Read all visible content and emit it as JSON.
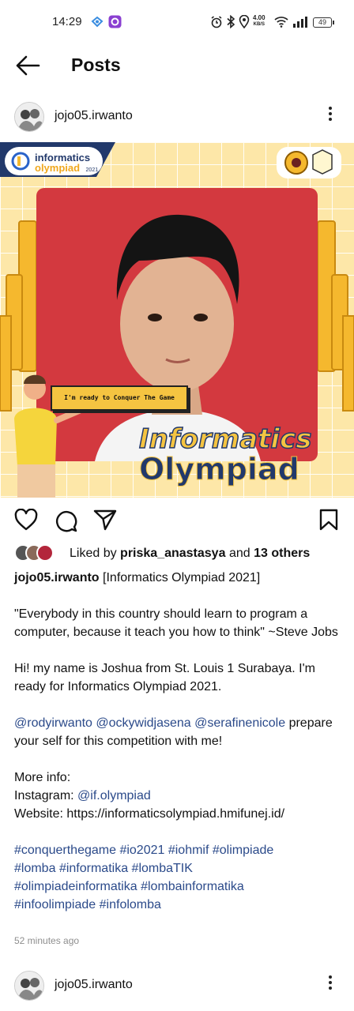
{
  "status_bar": {
    "time": "14:29",
    "speed_value": "4.00",
    "speed_unit": "KB/S",
    "battery": "49"
  },
  "header": {
    "title": "Posts"
  },
  "post": {
    "username": "jojo05.irwanto",
    "image": {
      "badge_line1": "informatics",
      "badge_line2": "olympiad",
      "badge_year": "2021",
      "speech_text": "I'm ready to Conquer The Game",
      "title_line1": "Informatics",
      "title_line2": "Olympiad"
    },
    "likes": {
      "prefix": "Liked by",
      "user": "priska_anastasya",
      "and": "and",
      "others": "13 others"
    },
    "caption": {
      "username": "jojo05.irwanto",
      "title": "[Informatics Olympiad 2021]",
      "quote": "\"Everybody in this country should learn to program a computer, because it teach you how to think\" ~Steve Jobs",
      "intro": "Hi! my name is Joshua from St. Louis 1 Surabaya. I'm ready for Informatics Olympiad 2021.",
      "mentions": [
        "@rodyirwanto",
        "@ockywidjasena",
        "@serafinenicole"
      ],
      "mention_text": "prepare your self for this competition with me!",
      "more_info": "More info:",
      "instagram_label": "Instagram:",
      "instagram_handle": "@if.olympiad",
      "website_label": "Website:",
      "website_url": "https://informaticsolympiad.hmifunej.id/",
      "hashtags": [
        "#conquerthegame",
        "#io2021",
        "#iohmif",
        "#olimpiade",
        "#lomba",
        "#informatika",
        "#lombaTIK",
        "#olimpiadeinformatika",
        "#lombainformatika",
        "#infoolimpiade",
        "#infolomba"
      ]
    },
    "time_ago": "52 minutes ago"
  },
  "next_post": {
    "username": "jojo05.irwanto"
  },
  "colors": {
    "link": "#2b4a8a",
    "image_bg": "#fde7a8",
    "photo_bg": "#d3393f",
    "accent_yellow": "#f5b82e",
    "navy": "#22396b"
  }
}
